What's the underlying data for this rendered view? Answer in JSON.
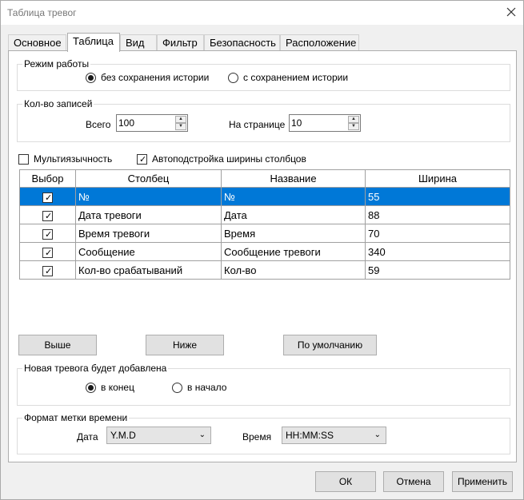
{
  "window": {
    "title": "Таблица тревог",
    "close_icon": "close-icon"
  },
  "tabs": [
    {
      "label": "Основное"
    },
    {
      "label": "Таблица"
    },
    {
      "label": "Вид"
    },
    {
      "label": "Фильтр"
    },
    {
      "label": "Безопасность"
    },
    {
      "label": "Расположение"
    }
  ],
  "active_tab": "Таблица",
  "mode": {
    "title": "Режим работы",
    "options": [
      "без сохранения истории",
      "с сохранением истории"
    ],
    "selected": "без сохранения истории"
  },
  "records": {
    "title": "Кол-во записей",
    "total_label": "Всего",
    "total_value": "100",
    "per_page_label": "На странице",
    "per_page_value": "10"
  },
  "options": {
    "multilang": {
      "label": "Мультиязычность",
      "checked": false
    },
    "autowidth": {
      "label": "Автоподстройка ширины столбцов",
      "checked": true
    }
  },
  "table": {
    "headers": [
      "Выбор",
      "Столбец",
      "Название",
      "Ширина"
    ],
    "rows": [
      {
        "column": "№",
        "name": "№",
        "width": "55",
        "checked": true,
        "selected": true
      },
      {
        "column": "Дата тревоги",
        "name": "Дата",
        "width": "88",
        "checked": true,
        "selected": false
      },
      {
        "column": "Время тревоги",
        "name": "Время",
        "width": "70",
        "checked": true,
        "selected": false
      },
      {
        "column": "Сообщение",
        "name": "Сообщение тревоги",
        "width": "340",
        "checked": true,
        "selected": false
      },
      {
        "column": "Кол-во срабатываний",
        "name": "Кол-во",
        "width": "59",
        "checked": true,
        "selected": false
      }
    ]
  },
  "buttons": {
    "up": "Выше",
    "down": "Ниже",
    "default": "По умолчанию"
  },
  "new_alarm": {
    "title": "Новая тревога будет добавлена",
    "options": [
      "в конец",
      "в начало"
    ],
    "selected": "в конец"
  },
  "timestamp": {
    "title": "Формат метки времени",
    "date_label": "Дата",
    "date_value": "Y.M.D",
    "time_label": "Время",
    "time_value": "HH:MM:SS"
  },
  "footer": {
    "ok": "ОК",
    "cancel": "Отмена",
    "apply": "Применить"
  },
  "colors": {
    "selection": "#0078d7",
    "window_bg": "#f0f0f0"
  }
}
